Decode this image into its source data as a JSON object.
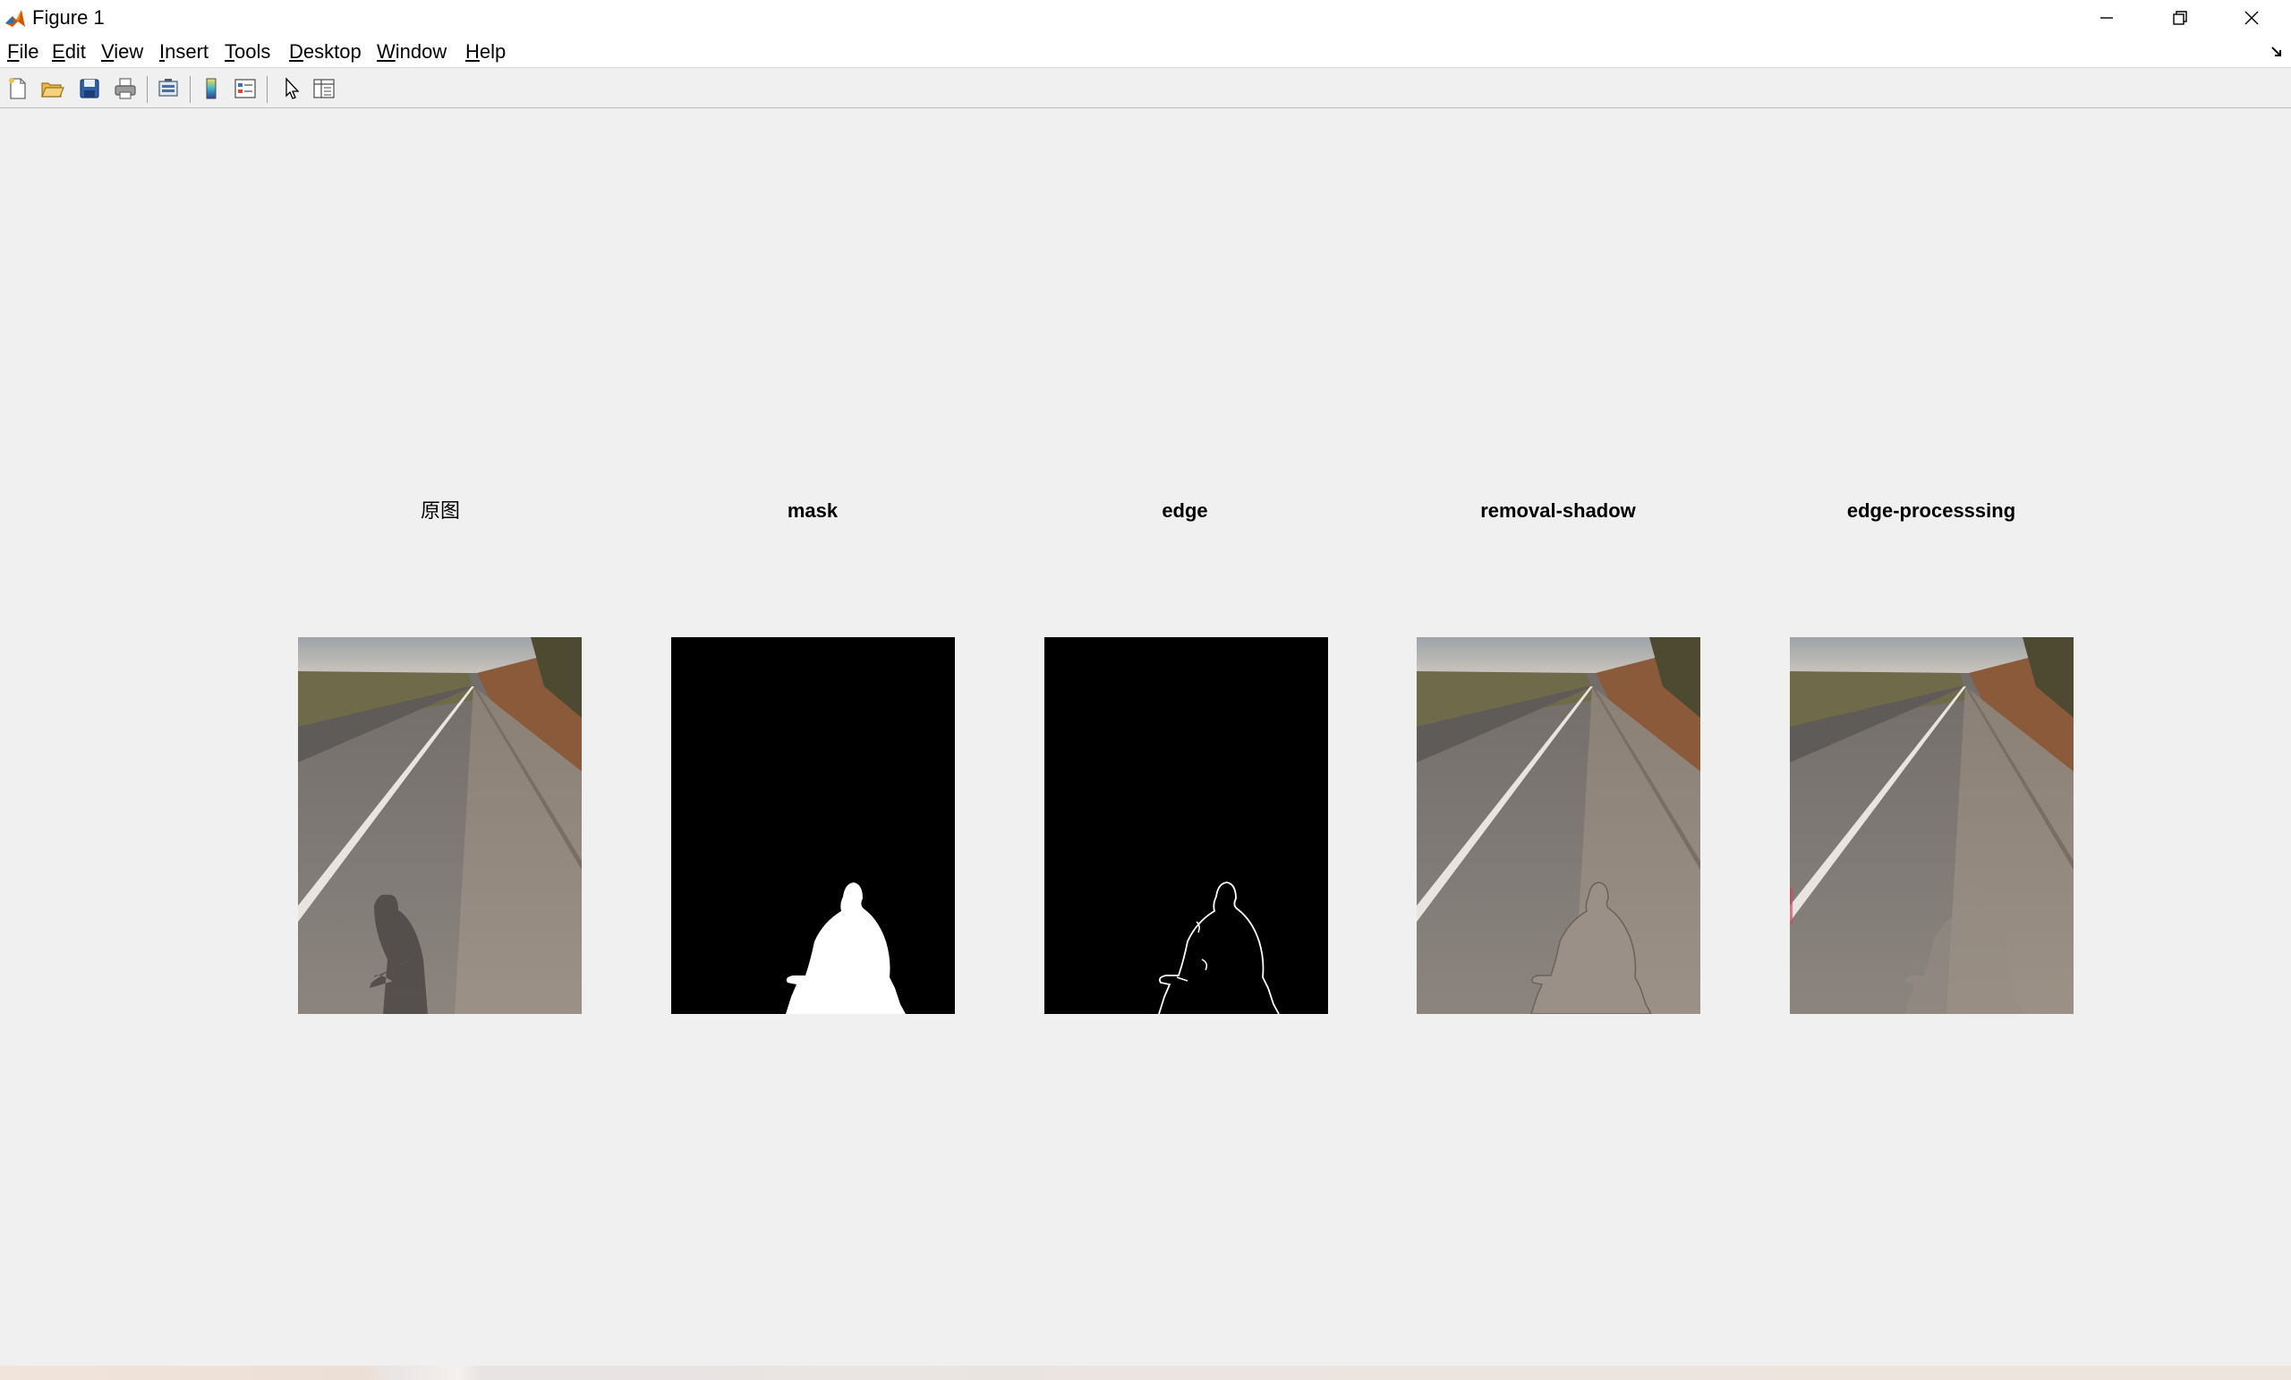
{
  "window": {
    "title": "Figure 1",
    "icon": "matlab-icon",
    "controls": [
      "minimize-icon",
      "restore-icon",
      "close-icon"
    ]
  },
  "menu": [
    {
      "label": "File",
      "mnemonic": "F",
      "rest": "ile"
    },
    {
      "label": "Edit",
      "mnemonic": "E",
      "rest": "dit"
    },
    {
      "label": "View",
      "mnemonic": "V",
      "rest": "iew"
    },
    {
      "label": "Insert",
      "mnemonic": "I",
      "rest": "nsert"
    },
    {
      "label": "Tools",
      "mnemonic": "T",
      "rest": "ools"
    },
    {
      "label": "Desktop",
      "mnemonic": "D",
      "rest": "esktop"
    },
    {
      "label": "Window",
      "mnemonic": "W",
      "rest": "indow"
    },
    {
      "label": "Help",
      "mnemonic": "H",
      "rest": "elp"
    }
  ],
  "toolbar": [
    "new-figure-icon",
    "open-file-icon",
    "save-icon",
    "print-icon",
    "link-plot-icon",
    "colorbar-icon",
    "legend-icon",
    "edit-plot-icon",
    "property-inspector-icon"
  ],
  "subplots": [
    {
      "title": "原图",
      "image": "original road photo with person shadow"
    },
    {
      "title": "mask",
      "image": "binary shadow mask"
    },
    {
      "title": "edge",
      "image": "shadow edge map"
    },
    {
      "title": "removal-shadow",
      "image": "road photo with shadow removed"
    },
    {
      "title": "edge-processsing",
      "image": "road photo after edge processing"
    }
  ],
  "colors": {
    "figure_bg": "#f0f0f0",
    "titlebar_bg": "#ffffff",
    "asphalt": "#8c857e",
    "sky": "#b8b6b4"
  }
}
